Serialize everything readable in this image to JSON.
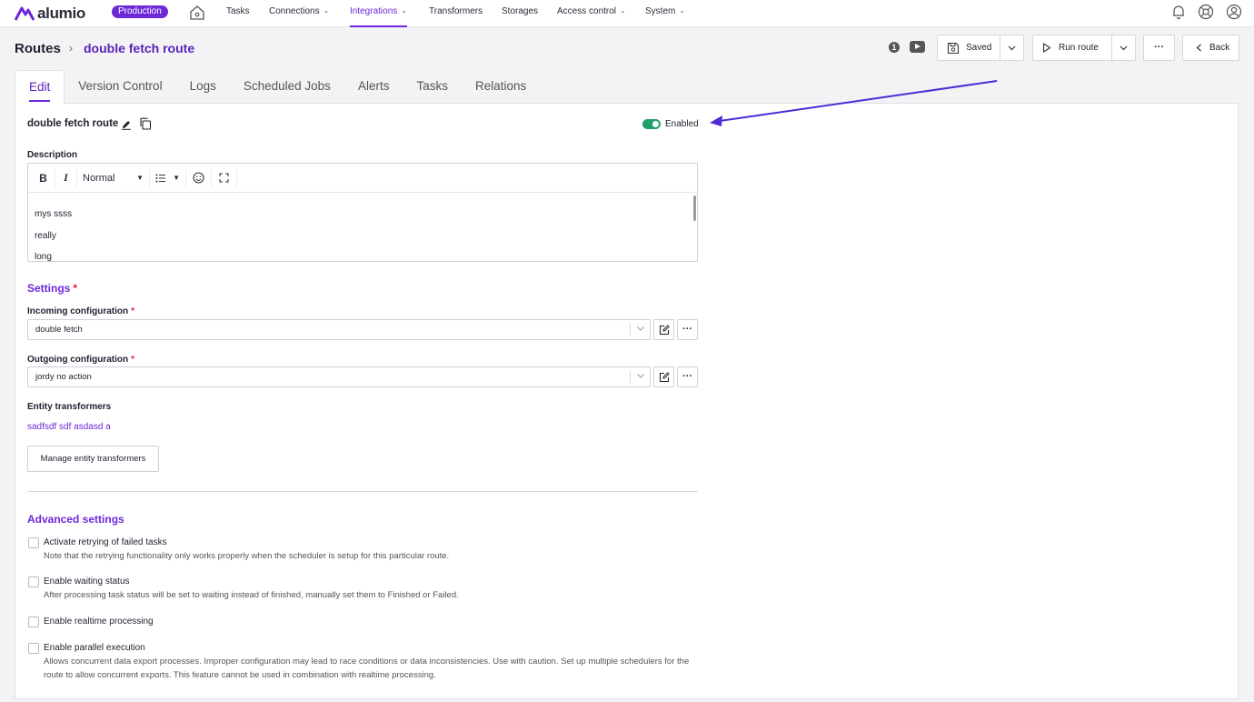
{
  "app": {
    "logo_text": "alumio",
    "environment": "Production"
  },
  "nav": {
    "items": [
      {
        "label": "Tasks"
      },
      {
        "label": "Connections"
      },
      {
        "label": "Integrations"
      },
      {
        "label": "Transformers"
      },
      {
        "label": "Storages"
      },
      {
        "label": "Access control"
      },
      {
        "label": "System"
      }
    ],
    "active": "Integrations"
  },
  "header": {
    "breadcrumb_root": "Routes",
    "breadcrumb_current": "double fetch route",
    "info_count": "1",
    "saved_label": "Saved",
    "run_label": "Run route",
    "back_label": "Back"
  },
  "tabs": [
    {
      "label": "Edit"
    },
    {
      "label": "Version Control"
    },
    {
      "label": "Logs"
    },
    {
      "label": "Scheduled Jobs"
    },
    {
      "label": "Alerts"
    },
    {
      "label": "Tasks"
    },
    {
      "label": "Relations"
    }
  ],
  "route": {
    "name": "double fetch route",
    "enabled_label": "Enabled",
    "enabled": true
  },
  "description": {
    "label": "Description",
    "format": "Normal",
    "lines": [
      "mys ssss",
      "really",
      "long"
    ]
  },
  "settings": {
    "title": "Settings",
    "incoming_label": "Incoming configuration",
    "incoming_value": "double fetch",
    "outgoing_label": "Outgoing configuration",
    "outgoing_value": "jordy no action",
    "entity_label": "Entity transformers",
    "entity_value": "sadfsdf sdf asdasd a",
    "manage_button": "Manage entity transformers"
  },
  "advanced": {
    "title": "Advanced settings",
    "options": [
      {
        "title": "Activate retrying of failed tasks",
        "desc": "Note that the retrying functionality only works properly when the scheduler is setup for this particular route.",
        "checked": false
      },
      {
        "title": "Enable waiting status",
        "desc": "After processing task status will be set to waiting instead of finished, manually set them to Finished or Failed.",
        "checked": false
      },
      {
        "title": "Enable realtime processing",
        "desc": "",
        "checked": false
      },
      {
        "title": "Enable parallel execution",
        "desc": "Allows concurrent data export processes. Improper configuration may lead to race conditions or data inconsistencies. Use with caution. Set up multiple schedulers for the route to allow concurrent exports. This feature cannot be used in combination with realtime processing.",
        "checked": false
      }
    ]
  },
  "colors": {
    "accent": "#6d28d9",
    "toggle_on": "#22a06b",
    "annotation_arrow": "#4f2ad6"
  }
}
